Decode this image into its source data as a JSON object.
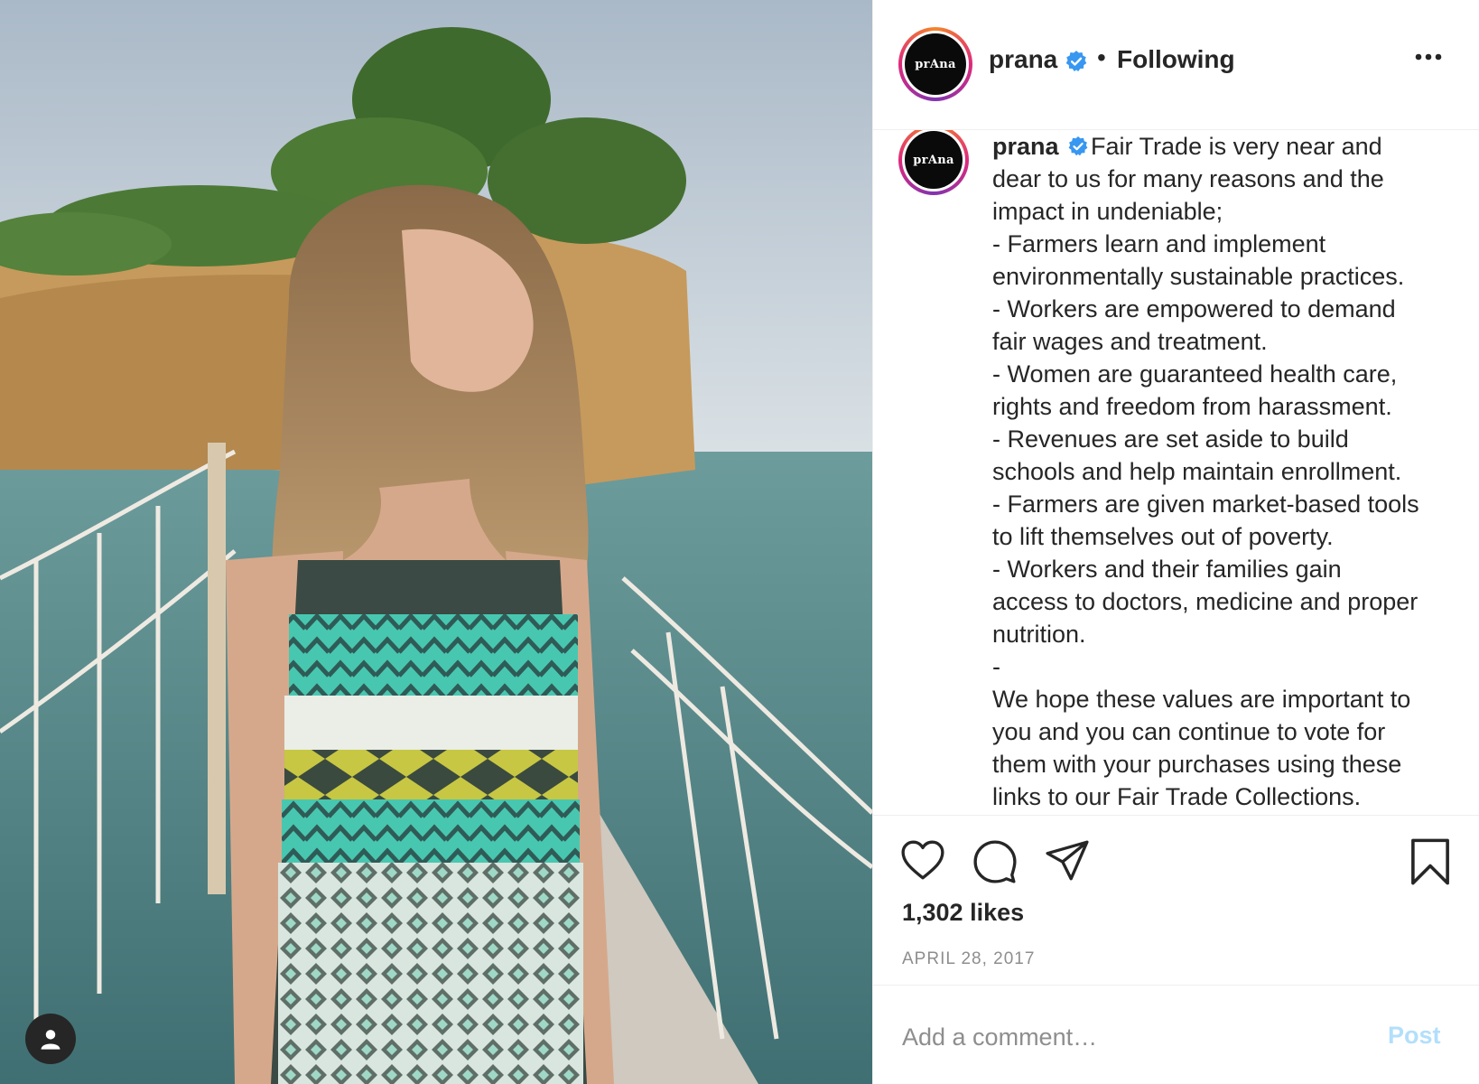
{
  "post": {
    "username": "prana",
    "avatar_text": "prAna",
    "follow_separator": "•",
    "follow_status": "Following",
    "caption_lines": [
      "Fair Trade is very near and",
      "dear to us for many reasons and the",
      "impact in undeniable;",
      "- Farmers learn and implement",
      "environmentally sustainable practices.",
      "- Workers are empowered to demand",
      "fair wages and treatment.",
      "- Women are guaranteed health care,",
      "rights and freedom from harassment.",
      "- Revenues are set aside to build",
      "schools and help maintain enrollment.",
      "- Farmers are given market-based tools",
      "to lift themselves out of poverty.",
      "- Workers and their families gain",
      "access to doctors, medicine and proper",
      "nutrition.",
      "-",
      "We hope these values are important to",
      "you and you can continue to vote for",
      "them with your purchases using these",
      "links to our Fair Trade Collections."
    ],
    "likes": "1,302 likes",
    "date": "APRIL 28, 2017"
  },
  "comment": {
    "placeholder": "Add a comment…",
    "post_label": "Post"
  },
  "colors": {
    "verified": "#3897f0",
    "post_disabled": "#b2dffc",
    "muted": "#8e8e8e"
  },
  "icons": [
    "heart-icon",
    "comment-icon",
    "share-icon",
    "bookmark-icon",
    "more-options-icon",
    "verified-badge-icon",
    "user-tag-icon"
  ]
}
